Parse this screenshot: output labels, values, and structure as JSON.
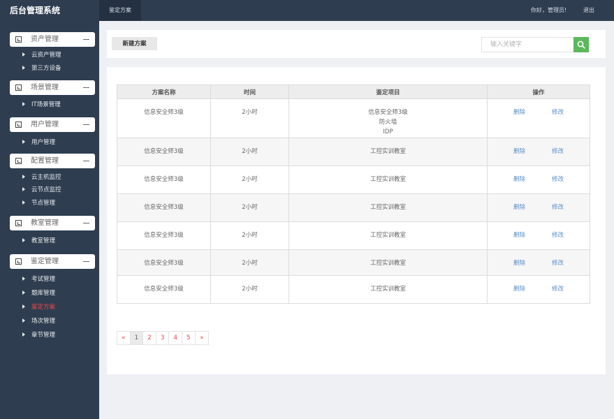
{
  "header": {
    "brand": "后台管理系统",
    "tab": "鉴定方案",
    "greeting": "你好，管理员!",
    "logout": "退出"
  },
  "sidebar": {
    "groups": [
      {
        "label": "资产管理",
        "items": [
          "云资产管理",
          "第三方设备"
        ]
      },
      {
        "label": "场景管理",
        "items": [
          "IT场景管理"
        ]
      },
      {
        "label": "用户管理",
        "items": [
          "用户管理"
        ]
      },
      {
        "label": "配置管理",
        "items": [
          "云主机监控",
          "云节点监控",
          "节点管理"
        ]
      },
      {
        "label": "教室管理",
        "items": [
          "教室管理"
        ]
      },
      {
        "label": "鉴定管理",
        "items": [
          "考试管理",
          "题库管理",
          "鉴定方案",
          "场次管理",
          "章节管理"
        ]
      }
    ],
    "active_item": "鉴定方案"
  },
  "toolbar": {
    "new_label": "新建方案",
    "search_placeholder": "输入关键字",
    "search_value": ""
  },
  "table": {
    "columns": [
      "方案名称",
      "时间",
      "鉴定项目",
      "操作"
    ],
    "delete_label": "删除",
    "edit_label": "修改",
    "rows": [
      {
        "name": "信息安全师3级",
        "time": "2小时",
        "project": [
          "信息安全师3级",
          "防火墙",
          "IDP"
        ]
      },
      {
        "name": "信息安全师3级",
        "time": "2小时",
        "project": [
          "工控实训教室"
        ]
      },
      {
        "name": "信息安全师3级",
        "time": "2小时",
        "project": [
          "工控实训教室"
        ]
      },
      {
        "name": "信息安全师3级",
        "time": "2小时",
        "project": [
          "工控实训教室"
        ]
      },
      {
        "name": "信息安全师3级",
        "time": "2小时",
        "project": [
          "工控实训教室"
        ]
      },
      {
        "name": "信息安全师3级",
        "time": "2小时",
        "project": [
          "工控实训教室"
        ]
      },
      {
        "name": "信息安全师3级",
        "time": "2小时",
        "project": [
          "工控实训教室"
        ]
      }
    ]
  },
  "pagination": {
    "prev": "«",
    "pages": [
      "1",
      "2",
      "3",
      "4",
      "5"
    ],
    "next": "»",
    "current": "1"
  },
  "colors": {
    "sidebar_bg": "#2f3d50",
    "accent_red": "#e84b4b",
    "link_blue": "#5b8fc7",
    "search_green": "#5cb85c"
  }
}
